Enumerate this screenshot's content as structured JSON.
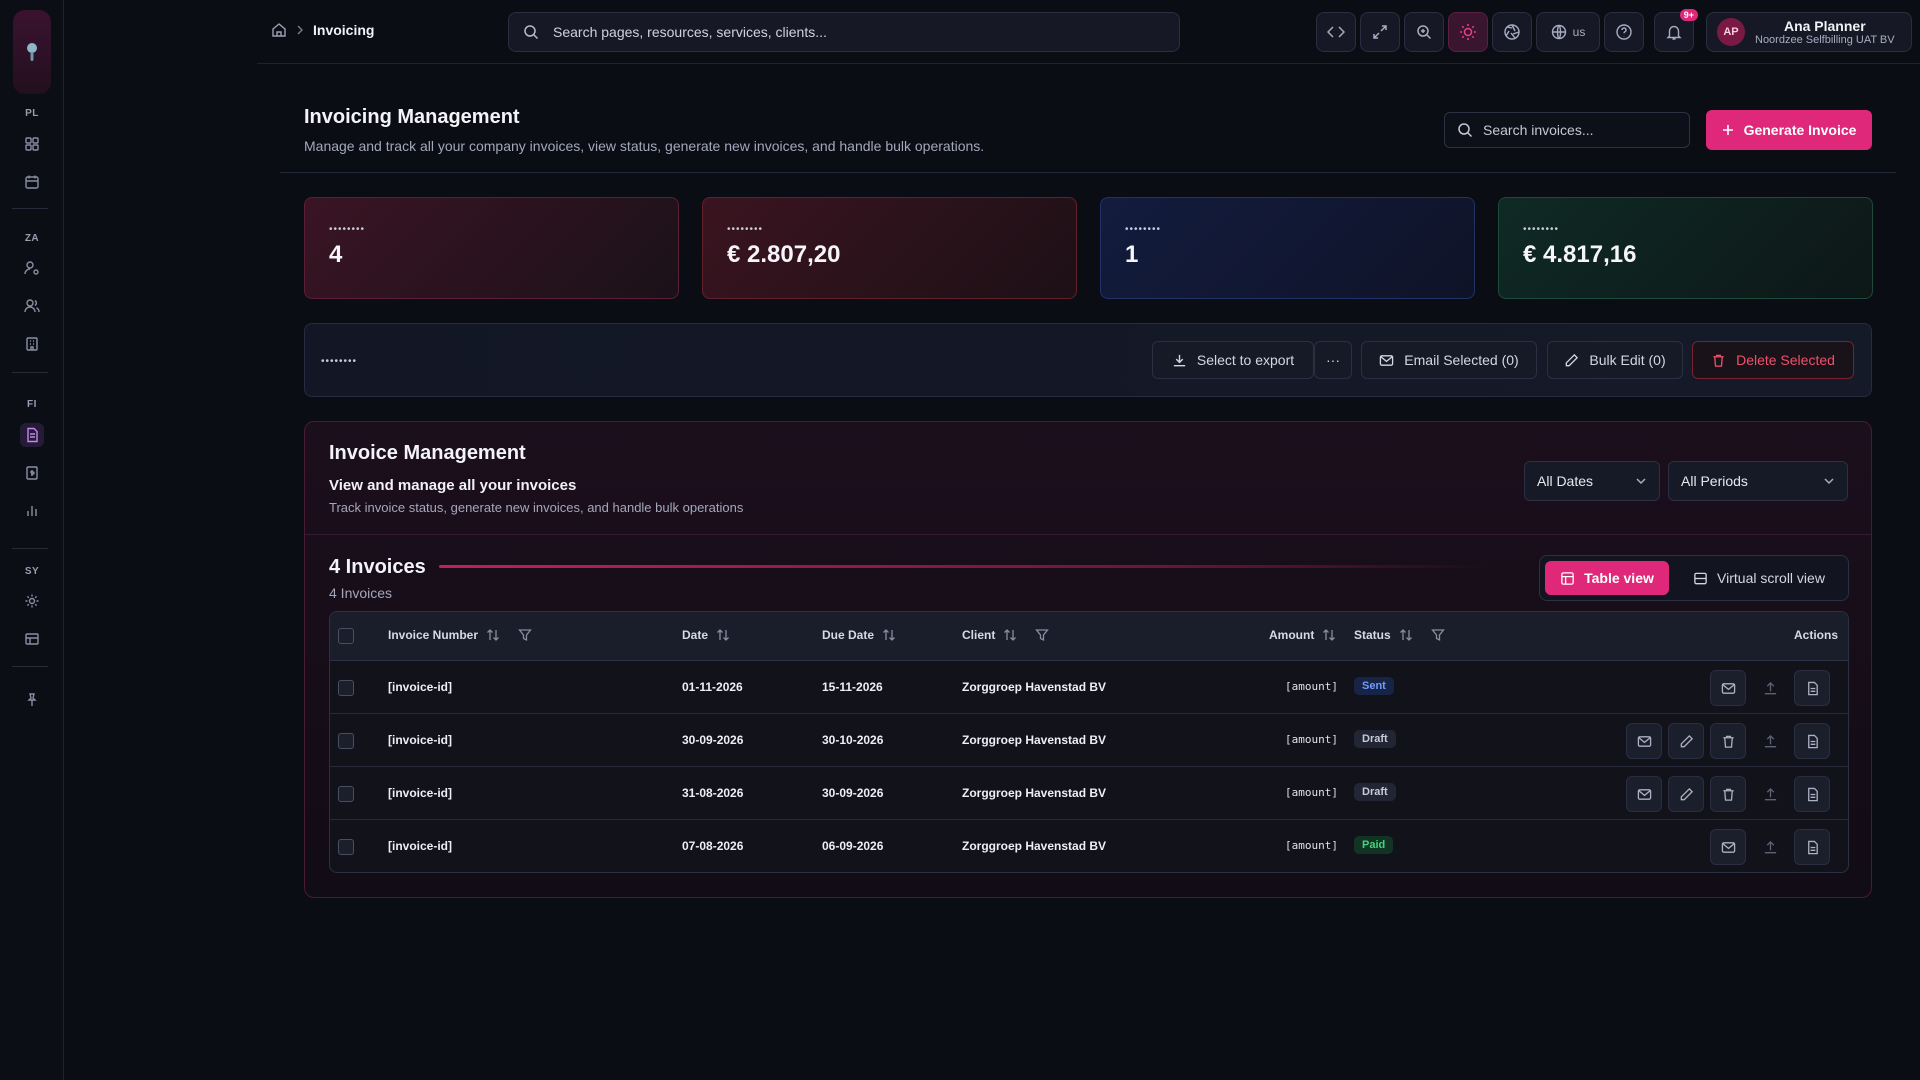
{
  "sidebar": {
    "sections": [
      {
        "label": "PL",
        "items": [
          "dashboard-icon",
          "calendar-icon"
        ]
      },
      {
        "label": "ZA",
        "items": [
          "user-cog-icon",
          "users-icon",
          "building-icon"
        ]
      },
      {
        "label": "FI",
        "items": [
          "invoice-icon",
          "receipt-icon",
          "bar-chart-icon"
        ]
      },
      {
        "label": "SY",
        "items": [
          "settings-icon",
          "table-icon"
        ]
      }
    ],
    "pin_icon": "pin-icon"
  },
  "header": {
    "breadcrumb_current": "Invoicing",
    "search_placeholder": "Search pages, resources, services, clients...",
    "language": "us",
    "notification_badge": "9+",
    "user": {
      "initials": "AP",
      "name": "Ana Planner",
      "org": "Noordzee Selfbilling UAT BV"
    }
  },
  "page": {
    "title": "Invoicing Management",
    "subtitle": "Manage and track all your company invoices, view status, generate new invoices, and handle bulk operations.",
    "search_placeholder": "Search invoices...",
    "generate_label": "Generate Invoice"
  },
  "stats": [
    {
      "label": "••••••••",
      "value": "4"
    },
    {
      "label": "••••••••",
      "value": "€ 2.807,20"
    },
    {
      "label": "••••••••",
      "value": "1"
    },
    {
      "label": "••••••••",
      "value": "€ 4.817,16"
    }
  ],
  "bulk": {
    "label": "••••••••",
    "select_export": "Select to export",
    "more": "···",
    "email_selected": "Email Selected (0)",
    "bulk_edit": "Bulk Edit (0)",
    "delete_selected": "Delete Selected"
  },
  "panel": {
    "title": "Invoice Management",
    "heading": "View and manage all your invoices",
    "subtitle": "Track invoice status, generate new invoices, and handle bulk operations",
    "date_filter": "All Dates",
    "period_filter": "All Periods",
    "count_title": "4 Invoices",
    "count_sub": "4 Invoices",
    "table_view": "Table view",
    "virtual_view": "Virtual scroll view"
  },
  "table": {
    "columns": {
      "invoice_number": "Invoice Number",
      "date": "Date",
      "due_date": "Due Date",
      "client": "Client",
      "amount": "Amount",
      "status": "Status",
      "actions": "Actions"
    },
    "rows": [
      {
        "invoice": "[invoice-id]",
        "date": "01-11-2026",
        "due": "15-11-2026",
        "client": "Zorggroep Havenstad BV",
        "amount": "[amount]",
        "status": "Sent"
      },
      {
        "invoice": "[invoice-id]",
        "date": "30-09-2026",
        "due": "30-10-2026",
        "client": "Zorggroep Havenstad BV",
        "amount": "[amount]",
        "status": "Draft"
      },
      {
        "invoice": "[invoice-id]",
        "date": "31-08-2026",
        "due": "30-09-2026",
        "client": "Zorggroep Havenstad BV",
        "amount": "[amount]",
        "status": "Draft"
      },
      {
        "invoice": "[invoice-id]",
        "date": "07-08-2026",
        "due": "06-09-2026",
        "client": "Zorggroep Havenstad BV",
        "amount": "[amount]",
        "status": "Paid"
      }
    ]
  },
  "colors": {
    "accent": "#e0287a",
    "sent": "#6f9bff",
    "paid": "#44d27e",
    "danger": "#f0506a"
  }
}
